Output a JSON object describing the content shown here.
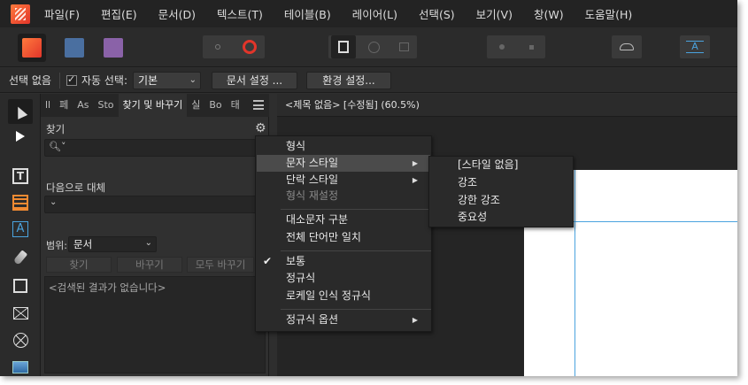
{
  "menubar": {
    "items": [
      "파일(F)",
      "편집(E)",
      "문서(D)",
      "텍스트(T)",
      "테이블(B)",
      "레이어(L)",
      "선택(S)",
      "보기(V)",
      "창(W)",
      "도움말(H)"
    ]
  },
  "toolbar": {
    "personas": [
      "publisher-persona-icon",
      "designer-persona-icon",
      "photo-persona-icon"
    ],
    "accent": "#e2352a"
  },
  "contextbar": {
    "no_selection": "선택 없음",
    "auto_select_label": "자동 선택:",
    "auto_select_value": "기본",
    "document_setup": "문서 설정 ...",
    "preferences": "환경 설정..."
  },
  "panel": {
    "tabs": [
      "ll",
      "페",
      "As",
      "Sto",
      "찾기 및 바꾸기",
      "실",
      "Bo",
      "태"
    ],
    "find_label": "찾기",
    "replace_label": "다음으로 대체",
    "scope_label": "범위:",
    "scope_value": "문서",
    "find_button": "찾기",
    "replace_button": "바꾸기",
    "replace_all_button": "모두 바꾸기",
    "results_text": "<검색된 결과가 없습니다>"
  },
  "document": {
    "tab_title": "<제목 없음> [수정됨] (60.5%)"
  },
  "context_menu": {
    "items": [
      {
        "label": "형식"
      },
      {
        "label": "문자 스타일",
        "submenu": true,
        "highlighted": true
      },
      {
        "label": "단락 스타일",
        "submenu": true
      },
      {
        "label": "형식 재설정",
        "disabled": true
      },
      {
        "label": "대소문자 구분"
      },
      {
        "label": "전체 단어만 일치"
      },
      {
        "label": "보통",
        "checked": true
      },
      {
        "label": "정규식"
      },
      {
        "label": "로케일 인식 정규식"
      },
      {
        "label": "정규식 옵션",
        "submenu": true
      }
    ],
    "submenu_items": [
      "[스타일 없음]",
      "강조",
      "강한 강조",
      "중요성"
    ]
  }
}
